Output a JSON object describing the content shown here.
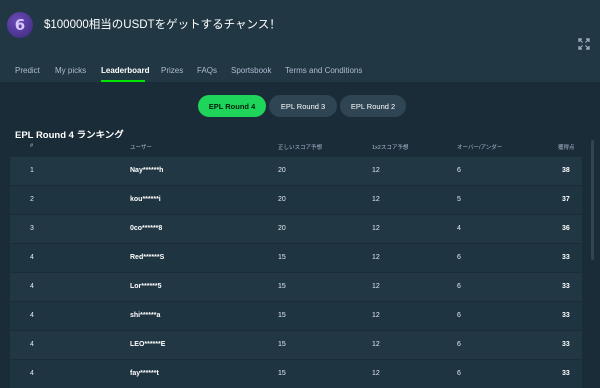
{
  "header": {
    "logo_text": "6",
    "title": "$100000相当のUSDTをゲットするチャンス！",
    "expand_icon": "expand-icon"
  },
  "tabs": [
    {
      "label": "Predict",
      "active": false
    },
    {
      "label": "My picks",
      "active": false
    },
    {
      "label": "Leaderboard",
      "active": true
    },
    {
      "label": "Prizes",
      "active": false
    },
    {
      "label": "FAQs",
      "active": false
    },
    {
      "label": "Sportsbook",
      "active": false
    },
    {
      "label": "Terms and Conditions",
      "active": false
    }
  ],
  "rounds": [
    {
      "label": "EPL Round 4",
      "active": true
    },
    {
      "label": "EPL Round 3",
      "active": false
    },
    {
      "label": "EPL Round 2",
      "active": false
    }
  ],
  "board_title": "EPL Round 4 ランキング",
  "columns": [
    "#",
    "ユーザー",
    "正しいスコア予想",
    "1x2スコア予想",
    "オーバー/アンダー",
    "獲得点"
  ],
  "rows": [
    {
      "rank": "1",
      "user": "Nay******h",
      "correct": "20",
      "x12": "12",
      "ou": "6",
      "total": "38"
    },
    {
      "rank": "2",
      "user": "kou******i",
      "correct": "20",
      "x12": "12",
      "ou": "5",
      "total": "37"
    },
    {
      "rank": "3",
      "user": "0co******8",
      "correct": "20",
      "x12": "12",
      "ou": "4",
      "total": "36"
    },
    {
      "rank": "4",
      "user": "Red******S",
      "correct": "15",
      "x12": "12",
      "ou": "6",
      "total": "33"
    },
    {
      "rank": "4",
      "user": "Lor******5",
      "correct": "15",
      "x12": "12",
      "ou": "6",
      "total": "33"
    },
    {
      "rank": "4",
      "user": "shi******a",
      "correct": "15",
      "x12": "12",
      "ou": "6",
      "total": "33"
    },
    {
      "rank": "4",
      "user": "LEO******E",
      "correct": "15",
      "x12": "12",
      "ou": "6",
      "total": "33"
    },
    {
      "rank": "4",
      "user": "fay******t",
      "correct": "15",
      "x12": "12",
      "ou": "6",
      "total": "33"
    }
  ],
  "colors": {
    "accent": "#1fd45a",
    "background": "#1a2c38",
    "panel": "#213743"
  }
}
